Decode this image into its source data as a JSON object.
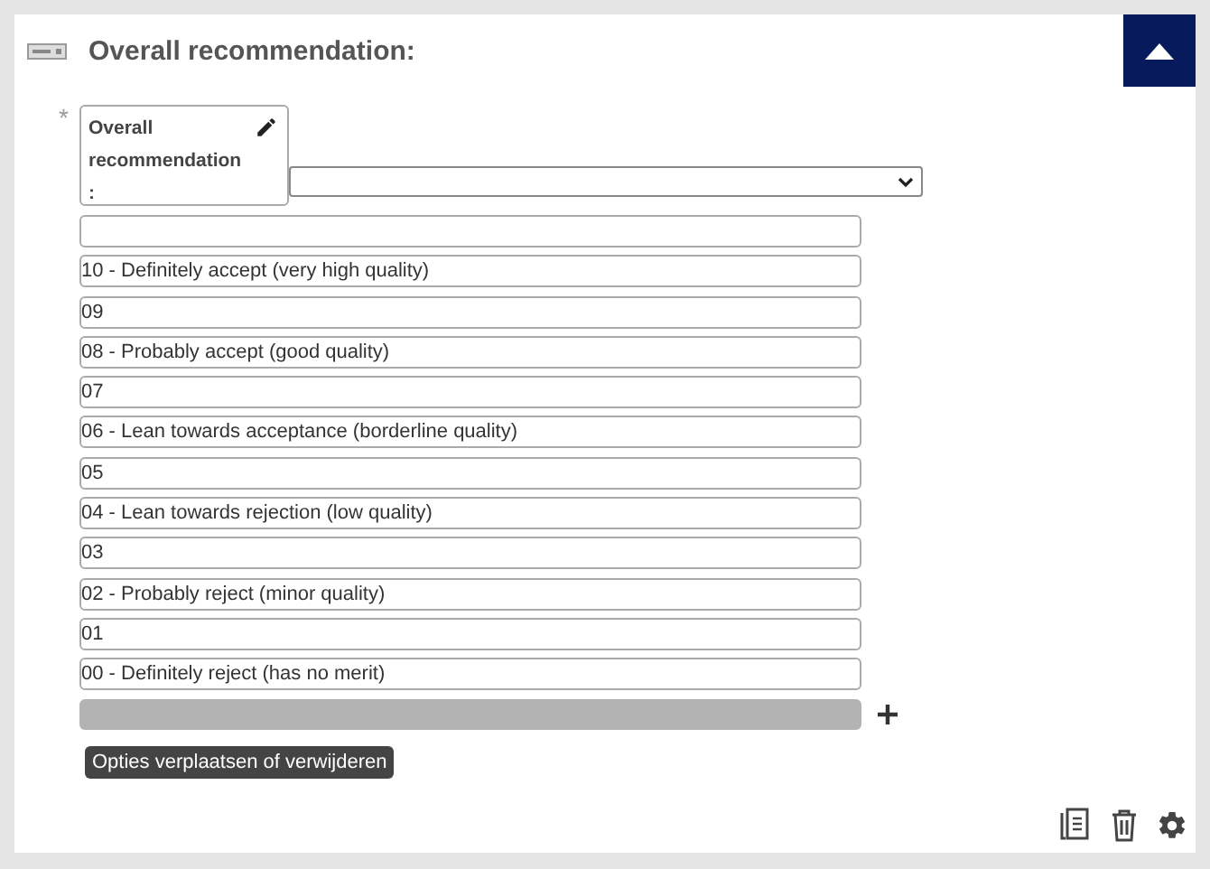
{
  "header": {
    "title": "Overall recommendation:",
    "required_mark": "*"
  },
  "question": {
    "label": "Overall recommendation:"
  },
  "options": [
    {
      "value": "10 - Definitely accept (very high quality)"
    },
    {
      "value": "09"
    },
    {
      "value": "08 - Probably accept (good quality)"
    },
    {
      "value": "07"
    },
    {
      "value": "06 - Lean towards acceptance (borderline quality)"
    },
    {
      "value": "05"
    },
    {
      "value": "04 - Lean towards rejection (low quality)"
    },
    {
      "value": "03"
    },
    {
      "value": "02 - Probably reject (minor quality)"
    },
    {
      "value": "01"
    },
    {
      "value": "00 - Definitely reject (has no merit)"
    }
  ],
  "tooltip": "Opties verplaatsen of verwijderen"
}
